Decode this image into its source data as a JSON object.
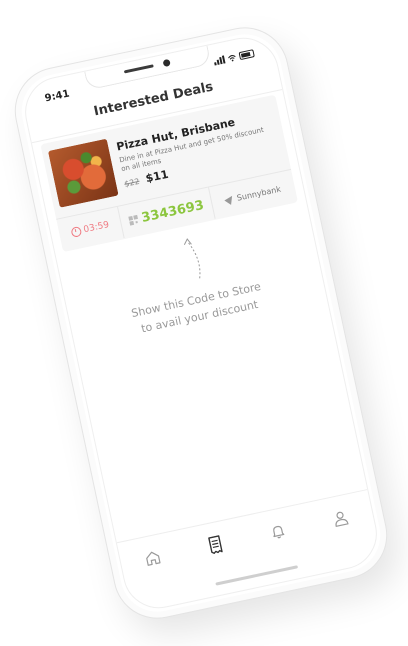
{
  "status_bar": {
    "time": "9:41"
  },
  "header": {
    "title": "Interested Deals"
  },
  "deal": {
    "title": "Pizza Hut, Brisbane",
    "description": "Dine in at Pizza Hut and get  50% discount on all items",
    "old_price": "$22",
    "new_price": "$11",
    "timer": "03:59",
    "code": "3343693",
    "location": "Sunnybank"
  },
  "hint": {
    "line1": "Show this Code to Store",
    "line2": "to avail your discount"
  },
  "tabbar": {
    "items": [
      "home-icon",
      "receipt-icon",
      "bell-icon",
      "profile-icon"
    ]
  },
  "colors": {
    "timer": "#f07b83",
    "code": "#8cc63f",
    "active_tab": "#333333",
    "inactive_tab": "#9a9a9a"
  }
}
